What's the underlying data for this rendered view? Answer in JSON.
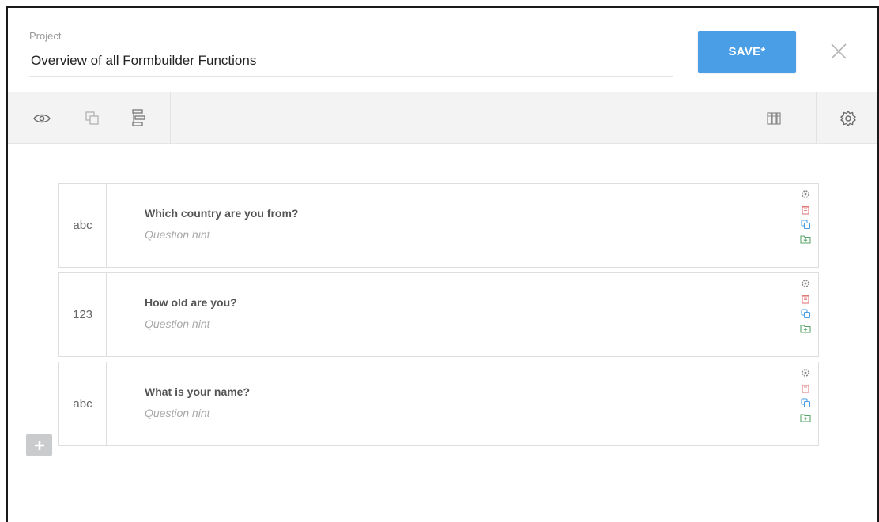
{
  "header": {
    "project_label": "Project",
    "project_name": "Overview of all Formbuilder Functions",
    "save_label": "SAVE*"
  },
  "toolbar": {
    "left_icons": [
      "eye-icon",
      "copy-icon",
      "logic-icon"
    ],
    "right_icons": [
      "columns-icon",
      "gear-icon"
    ]
  },
  "questions": [
    {
      "type": "abc",
      "title": "Which country are you from?",
      "hint": "Question hint"
    },
    {
      "type": "123",
      "title": "How old are you?",
      "hint": "Question hint"
    },
    {
      "type": "abc",
      "title": "What is your name?",
      "hint": "Question hint"
    }
  ],
  "colors": {
    "accent": "#4a9ee6",
    "delete": "#e07b7b",
    "duplicate": "#4a9ee6",
    "add_to_library": "#5aa66a"
  }
}
